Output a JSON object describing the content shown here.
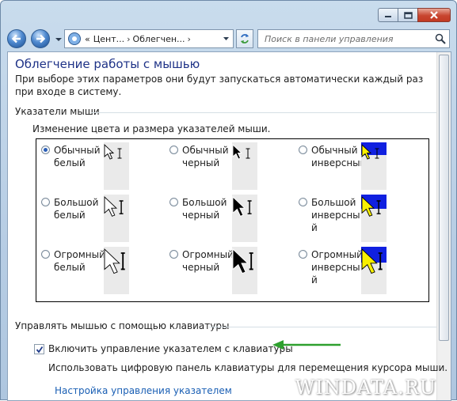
{
  "window": {
    "minimize_icon": "minimize-icon",
    "maximize_icon": "maximize-icon",
    "close_icon": "close-icon"
  },
  "navigation": {
    "back_icon": "back-arrow-icon",
    "forward_icon": "forward-arrow-icon",
    "address": {
      "prefix": "«",
      "crumb1": "Цент...",
      "crumb2": "Облегчен...",
      "separator": "›"
    },
    "search_placeholder": "Поиск в панели управления"
  },
  "page": {
    "title": "Облегчение работы с мышью",
    "intro": "При выборе этих параметров они будут запускаться автоматически каждый раз при входе в систему."
  },
  "pointers_section": {
    "heading": "Указатели мыши",
    "subheading": "Изменение цвета и размера указателей мыши.",
    "options": [
      {
        "line1": "Обычный",
        "line2": "белый",
        "line3": "",
        "selected": true,
        "scheme": "white",
        "size": "normal"
      },
      {
        "line1": "Обычный",
        "line2": "черный",
        "line3": "",
        "selected": false,
        "scheme": "black",
        "size": "normal"
      },
      {
        "line1": "Обычный",
        "line2": "инверсный",
        "line3": "",
        "selected": false,
        "scheme": "inverse",
        "size": "normal"
      },
      {
        "line1": "Большой",
        "line2": "белый",
        "line3": "",
        "selected": false,
        "scheme": "white",
        "size": "large"
      },
      {
        "line1": "Большой",
        "line2": "черный",
        "line3": "",
        "selected": false,
        "scheme": "black",
        "size": "large"
      },
      {
        "line1": "Большой",
        "line2": "инверсны",
        "line3": "й",
        "selected": false,
        "scheme": "inverse",
        "size": "large"
      },
      {
        "line1": "Огромный",
        "line2": "белый",
        "line3": "",
        "selected": false,
        "scheme": "white",
        "size": "huge"
      },
      {
        "line1": "Огромный",
        "line2": "черный",
        "line3": "",
        "selected": false,
        "scheme": "black",
        "size": "huge"
      },
      {
        "line1": "Огромный",
        "line2": "инверсны",
        "line3": "й",
        "selected": false,
        "scheme": "inverse",
        "size": "huge"
      }
    ]
  },
  "keyboard_section": {
    "heading": "Управлять мышью с помощью клавиатуры",
    "checkbox_label": "Включить управление указателем с клавиатуры",
    "checkbox_checked": true,
    "description": "Использовать цифровую панель клавиатуры для перемещения курсора мыши.",
    "link": "Настройка управления указателем"
  },
  "watermark": "WINDATA.RU",
  "colors": {
    "title_blue": "#1e3287",
    "link_blue": "#1a5fb4",
    "arrow_green": "#2ea02e",
    "inverse_blue": "#1020e0",
    "inverse_yellow": "#f8f000"
  }
}
